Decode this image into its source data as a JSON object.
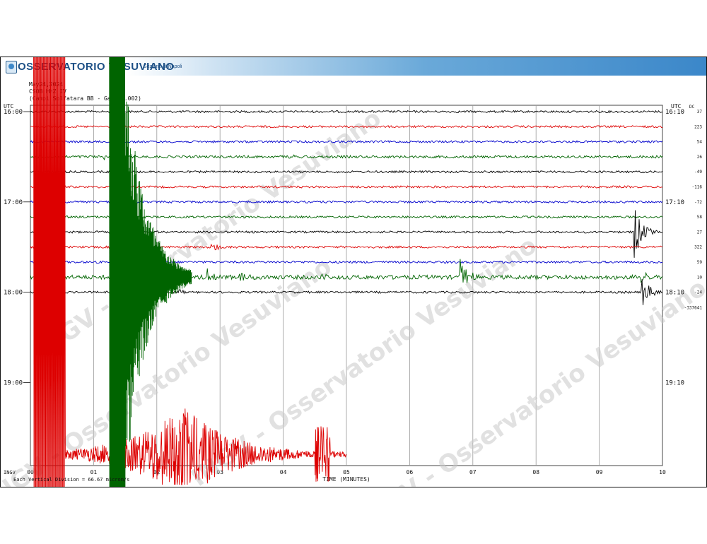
{
  "header": {
    "title": "OSSERVATORIO VESUVIANO",
    "subtitle": "Sezione di Napoli"
  },
  "meta": {
    "date": "May24,2024",
    "station": "CSOB HHZ IV",
    "site": "(Campi Solfatara BB - Gain 0.002)"
  },
  "footer": {
    "division_note": "Each Vertical Division = 66.67 microm/s",
    "credit": "INGV"
  },
  "watermark_text": "INGV - Osservatorio Vesuviano",
  "chart_data": {
    "type": "line",
    "title": "",
    "xlabel": "TIME (MINUTES)",
    "ylabel": "",
    "xlim": [
      0,
      10
    ],
    "x_ticks": [
      "00",
      "01",
      "02",
      "03",
      "04",
      "05",
      "06",
      "07",
      "08",
      "09",
      "10"
    ],
    "left_axis_label": "UTC",
    "right_axis_label": "UTC",
    "left_time_labels": [
      {
        "label": "16:00",
        "row": 0
      },
      {
        "label": "17:00",
        "row": 6
      },
      {
        "label": "18:00",
        "row": 12
      },
      {
        "label": "19:00",
        "row": 18
      }
    ],
    "right_time_labels": [
      {
        "label": "16:10",
        "row": 0
      },
      {
        "label": "17:10",
        "row": 6
      },
      {
        "label": "18:10",
        "row": 12
      },
      {
        "label": "19:10",
        "row": 18
      }
    ],
    "right_header": "DC",
    "right_values": [
      "37",
      "223",
      "54",
      "26",
      "-49",
      "-116",
      "-72",
      "58",
      "27",
      "322",
      "59",
      "10",
      "-24",
      "-337641"
    ],
    "series_colors": [
      "#000000",
      "#dd0000",
      "#0000cc",
      "#006400"
    ],
    "traces": [
      {
        "row": 0,
        "color": "#000000",
        "amplitude": 1.5,
        "events": []
      },
      {
        "row": 1,
        "color": "#dd0000",
        "amplitude": 1.5,
        "events": []
      },
      {
        "row": 2,
        "color": "#0000cc",
        "amplitude": 1.5,
        "events": []
      },
      {
        "row": 3,
        "color": "#006400",
        "amplitude": 1.8,
        "events": [
          {
            "t": 1.15,
            "amp": 4
          },
          {
            "t": 4.05,
            "amp": 3
          }
        ]
      },
      {
        "row": 4,
        "color": "#000000",
        "amplitude": 1.5,
        "events": []
      },
      {
        "row": 5,
        "color": "#dd0000",
        "amplitude": 1.5,
        "events": []
      },
      {
        "row": 6,
        "color": "#0000cc",
        "amplitude": 1.5,
        "events": []
      },
      {
        "row": 7,
        "color": "#006400",
        "amplitude": 1.5,
        "events": []
      },
      {
        "row": 8,
        "color": "#000000",
        "amplitude": 1.5,
        "events": [
          {
            "t": 9.55,
            "amp": 40
          }
        ]
      },
      {
        "row": 9,
        "color": "#dd0000",
        "amplitude": 1.5,
        "events": [
          {
            "t": 2.85,
            "amp": 8
          }
        ]
      },
      {
        "row": 10,
        "color": "#0000cc",
        "amplitude": 1.5,
        "events": []
      },
      {
        "row": 11,
        "color": "#006400",
        "amplitude": 3,
        "events": [
          {
            "t": 2.2,
            "amp": 12
          },
          {
            "t": 2.8,
            "amp": 10
          },
          {
            "t": 3.3,
            "amp": 8
          },
          {
            "t": 4.6,
            "amp": 6
          },
          {
            "t": 6.8,
            "amp": 30
          },
          {
            "t": 8.8,
            "amp": 4
          },
          {
            "t": 9.65,
            "amp": 10
          }
        ]
      },
      {
        "row": 12,
        "color": "#000000",
        "amplitude": 1.5,
        "events": [
          {
            "t": 2.3,
            "amp": 4
          },
          {
            "t": 9.65,
            "amp": 30
          }
        ]
      }
    ],
    "red_event": {
      "start": 0.05,
      "end": 5.0,
      "peak_time": 2.4
    },
    "green_event": {
      "start": 1.25,
      "peak_time": 1.5
    }
  }
}
